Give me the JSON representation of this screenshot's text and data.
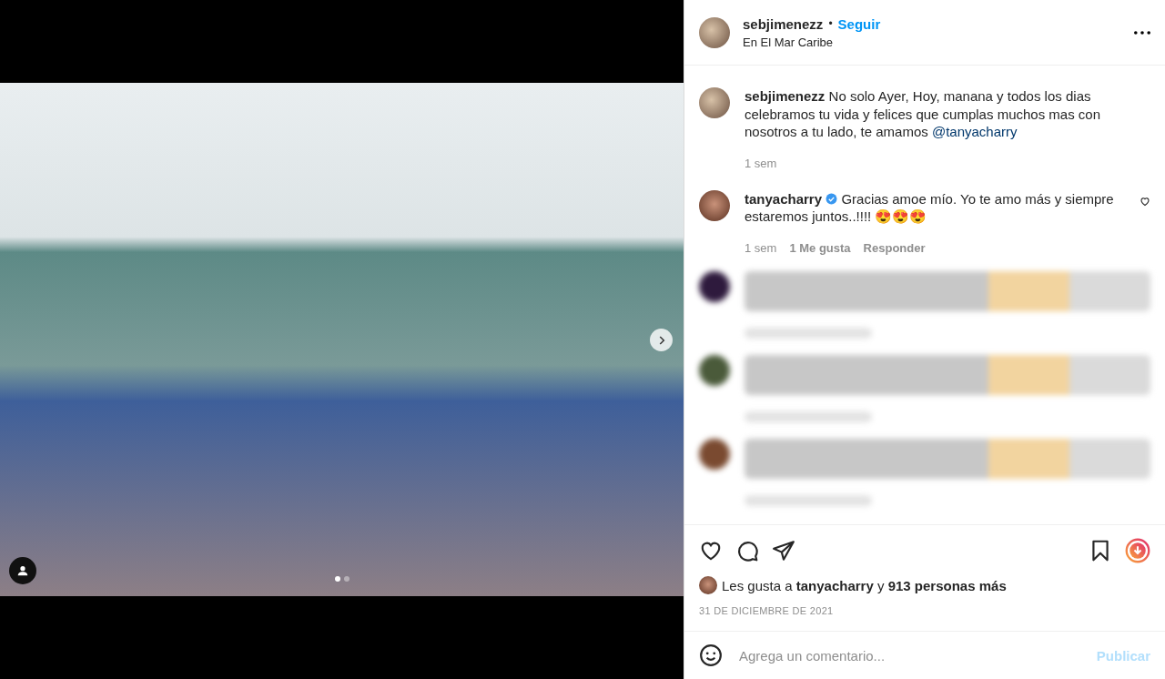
{
  "media": {
    "carousel_dots": [
      {
        "selected": true
      },
      {
        "selected": false
      }
    ]
  },
  "header": {
    "username": "sebjimenezz",
    "separator": "•",
    "follow": "Seguir",
    "location": "En El Mar Caribe"
  },
  "caption": {
    "username": "sebjimenezz",
    "text": "No solo Ayer, Hoy, manana y todos los dias celebramos tu vida y felices que cumplas muchos mas con nosotros a tu lado, te amamos ",
    "mention": "@tanyacharry",
    "time": "1 sem"
  },
  "comments": [
    {
      "username": "tanyacharry",
      "verified": true,
      "text": "Gracias amoe mío. Yo te amo más y siempre estaremos juntos..!!!! 😍😍😍",
      "time": "1 sem",
      "likes": "1 Me gusta",
      "reply": "Responder"
    }
  ],
  "blurred_comments": [
    {
      "color": "#2e1a3d"
    },
    {
      "color": "#4a5a3a"
    },
    {
      "color": "#7a4a30"
    }
  ],
  "likes": {
    "prefix": "Les gusta a ",
    "user": "tanyacharry",
    "middle": " y ",
    "count": "913 personas más"
  },
  "date": "31 DE DICIEMBRE DE 2021",
  "composer": {
    "placeholder": "Agrega un comentario...",
    "submit": "Publicar"
  }
}
